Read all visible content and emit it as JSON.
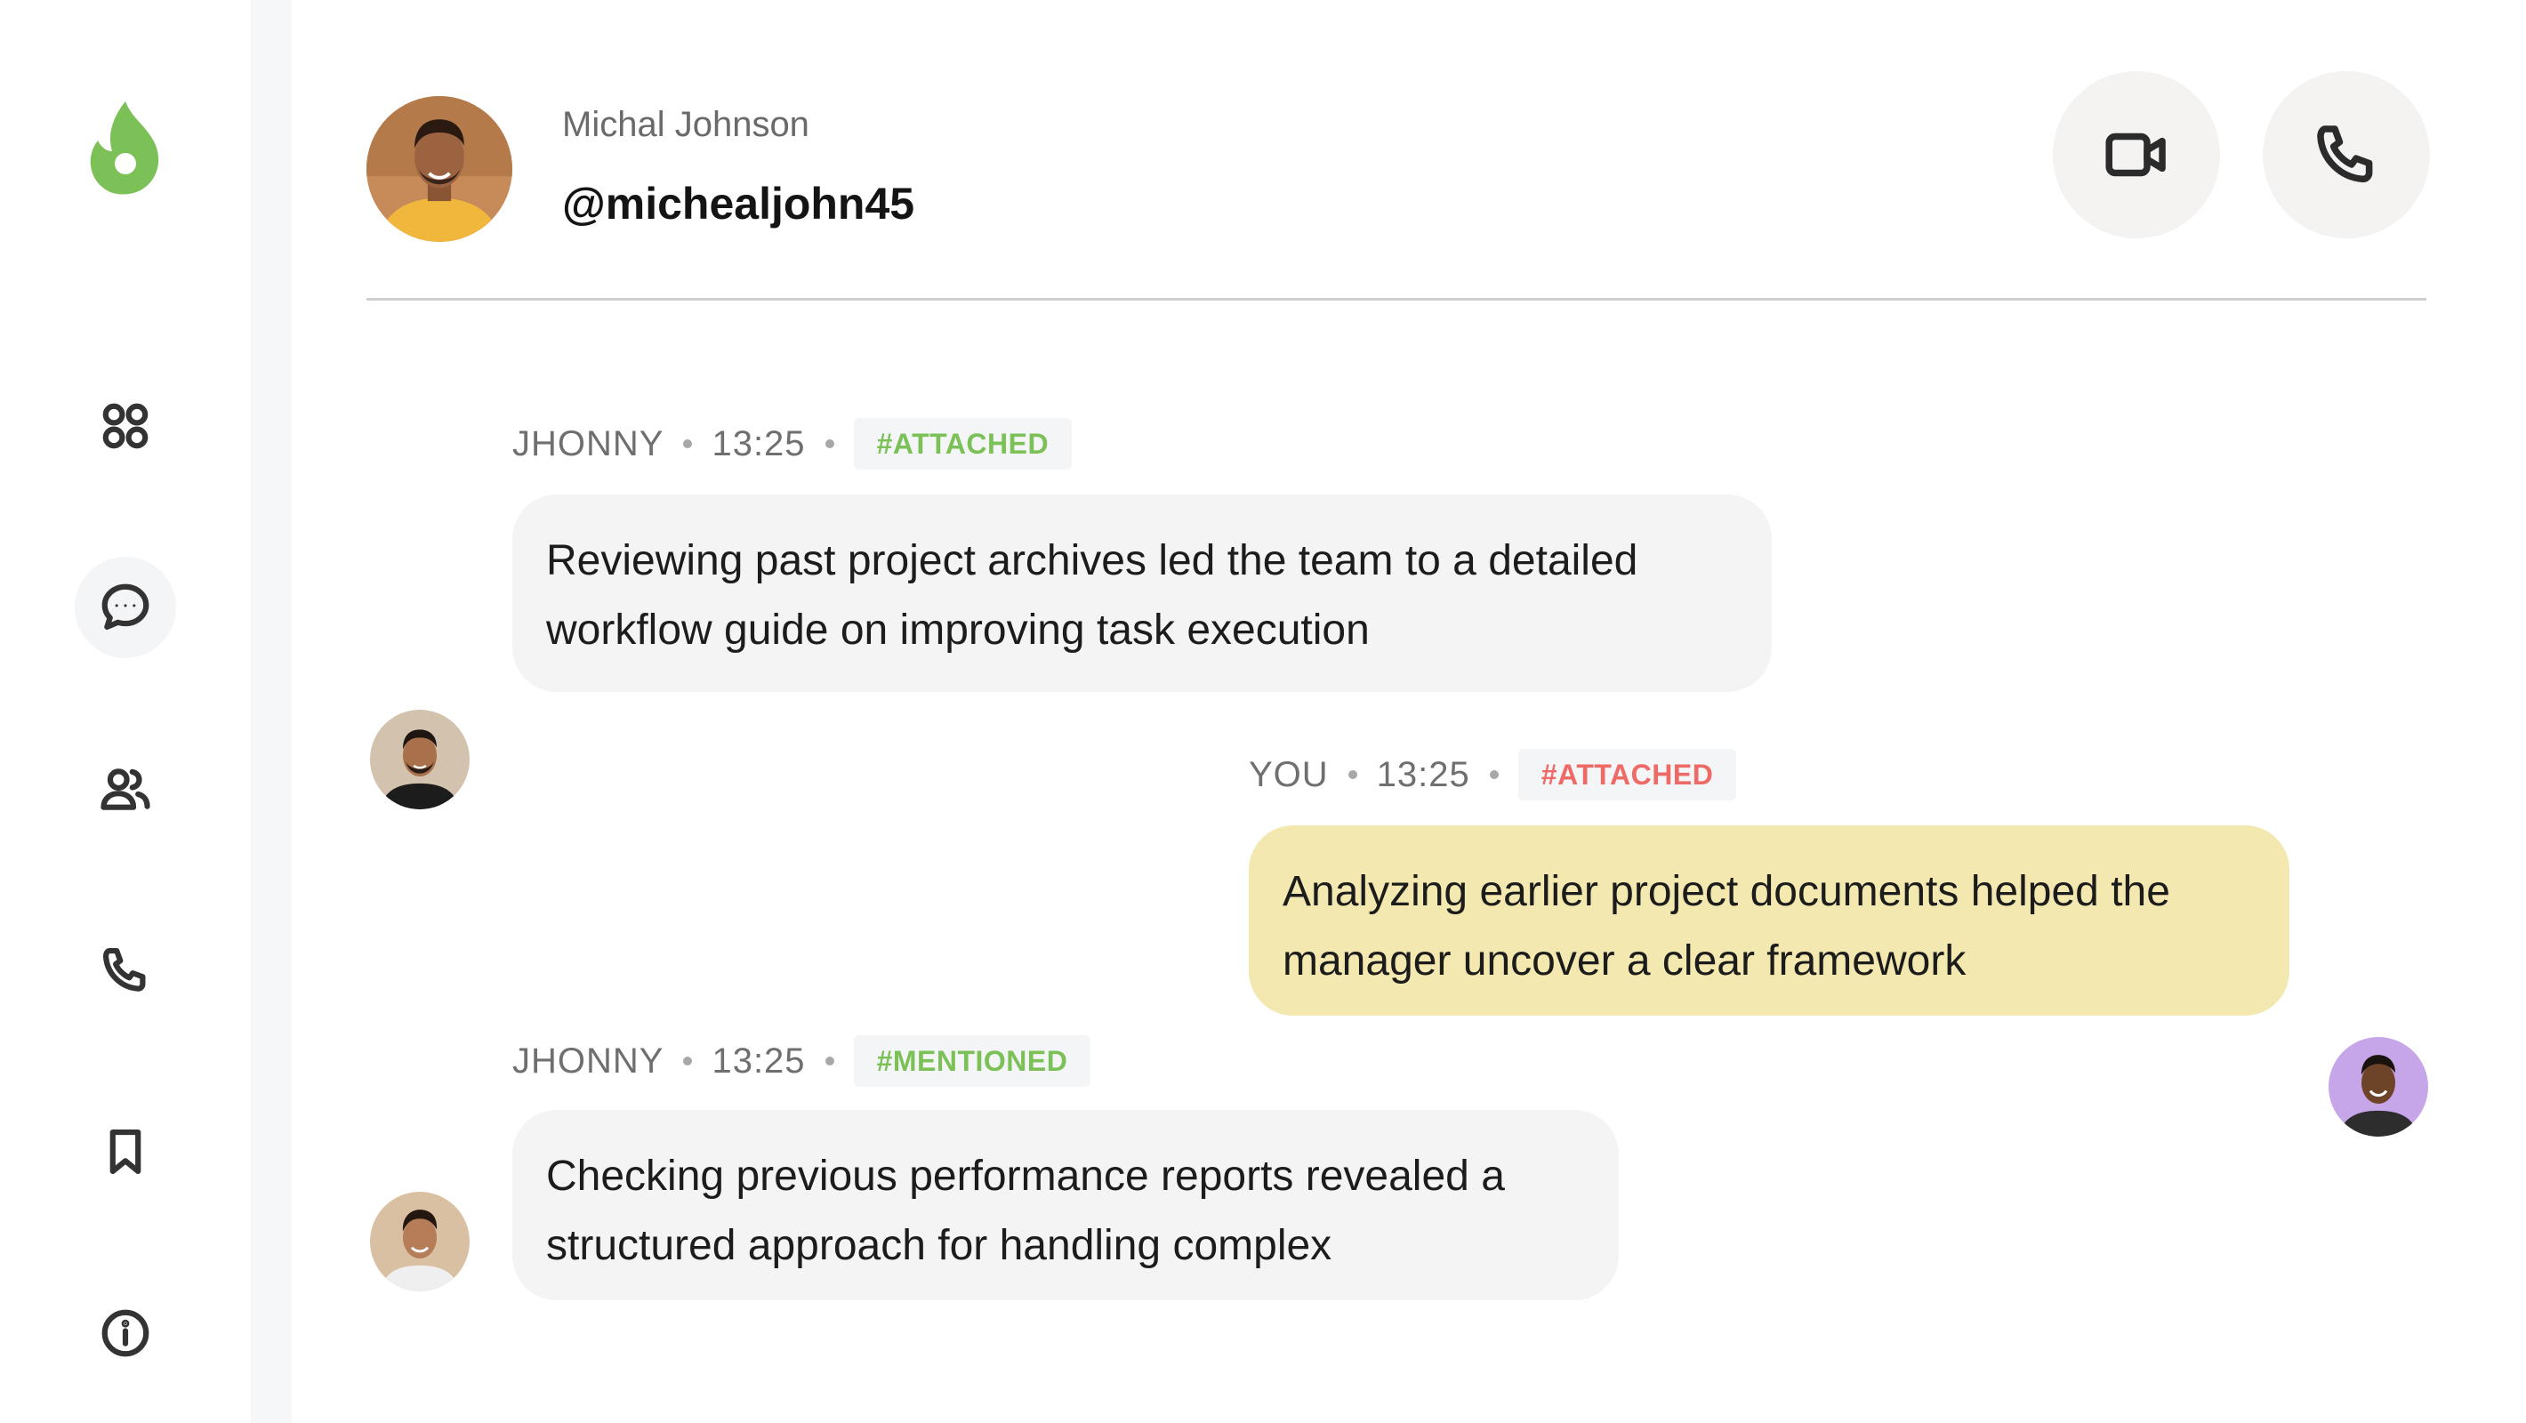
{
  "sidebar": {
    "logo_icon": "flame-logo-icon",
    "items": [
      {
        "name": "dashboard",
        "icon": "grid-icon",
        "active": false
      },
      {
        "name": "messages",
        "icon": "chat-bubble-icon",
        "active": true
      },
      {
        "name": "contacts",
        "icon": "users-icon",
        "active": false
      },
      {
        "name": "calls",
        "icon": "phone-icon",
        "active": false
      },
      {
        "name": "saved",
        "icon": "bookmark-icon",
        "active": false
      },
      {
        "name": "info",
        "icon": "info-icon",
        "active": false
      }
    ]
  },
  "header": {
    "name": "Michal Johnson",
    "handle": "@michealjohn45",
    "video_call_icon": "video-camera-icon",
    "voice_call_icon": "phone-icon"
  },
  "messages": [
    {
      "sender": "JHONNY",
      "time": "13:25",
      "tag": "#ATTACHED",
      "tag_color": "#7cc158",
      "lines": [
        "Reviewing past project archives led the team to a detailed",
        "workflow guide on improving task execution"
      ],
      "direction": "incoming"
    },
    {
      "sender": "YOU",
      "time": "13:25",
      "tag": "#ATTACHED",
      "tag_color": "#ee6a66",
      "lines": [
        "Analyzing earlier project documents helped the",
        "manager uncover a clear framework"
      ],
      "direction": "outgoing"
    },
    {
      "sender": "JHONNY",
      "time": "13:25",
      "tag": "#MENTIONED",
      "tag_color": "#7cc158",
      "lines": [
        "Checking previous performance reports revealed a",
        "structured approach for handling complex"
      ],
      "direction": "incoming"
    }
  ],
  "colors": {
    "accent_green": "#7cc158",
    "outgoing_bubble": "#f3e8af",
    "incoming_bubble": "#f4f4f4",
    "tag_red": "#ee6a66"
  }
}
